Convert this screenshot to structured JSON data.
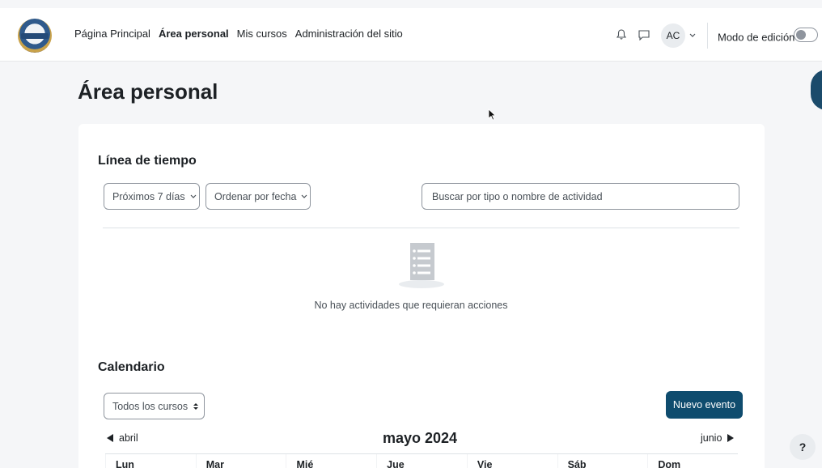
{
  "nav": {
    "links": [
      {
        "label": "Página Principal",
        "active": false
      },
      {
        "label": "Área personal",
        "active": true
      },
      {
        "label": "Mis cursos",
        "active": false
      },
      {
        "label": "Administración del sitio",
        "active": false
      }
    ],
    "avatar_initials": "AC",
    "edit_mode_label": "Modo de edición"
  },
  "page_title": "Área personal",
  "timeline": {
    "title": "Línea de tiempo",
    "filter_label": "Próximos 7 días",
    "sort_label": "Ordenar por fecha",
    "search_placeholder": "Buscar por tipo o nombre de actividad",
    "empty_message": "No hay actividades que requieran acciones"
  },
  "calendar": {
    "title": "Calendario",
    "course_filter": "Todos los cursos",
    "new_event_label": "Nuevo evento",
    "prev_month": "abril",
    "next_month": "junio",
    "current_month": "mayo 2024",
    "weekdays": [
      "Lun",
      "Mar",
      "Mié",
      "Jue",
      "Vie",
      "Sáb",
      "Dom"
    ]
  },
  "help_label": "?",
  "colors": {
    "primary": "#0f4c6e",
    "background": "#f5f6f8",
    "card": "#ffffff",
    "border": "#8f959e"
  }
}
